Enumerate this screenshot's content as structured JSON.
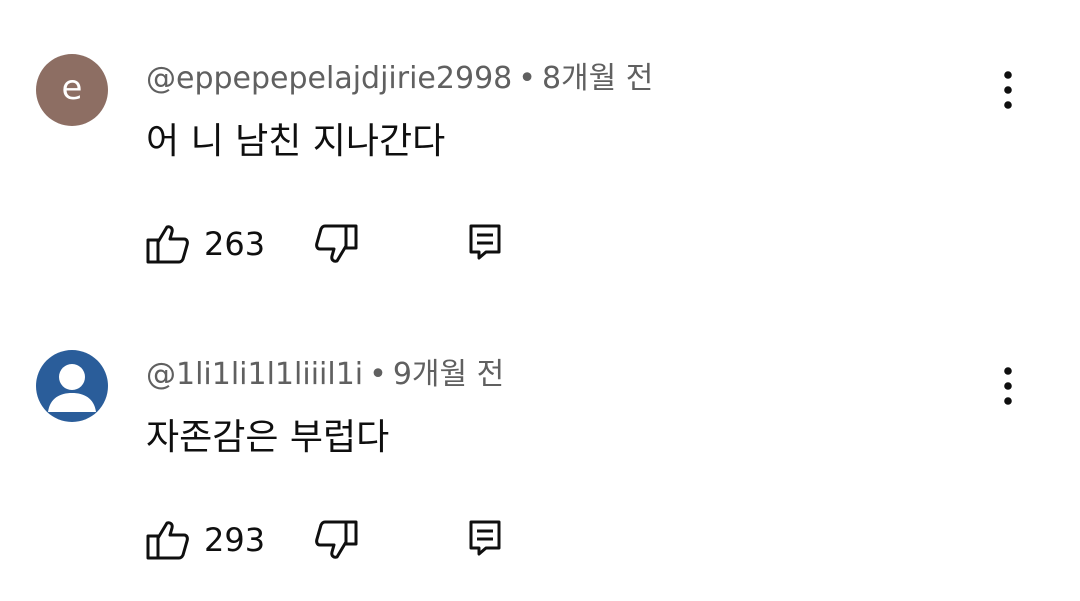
{
  "comments": [
    {
      "avatar": {
        "letter": "e",
        "color": "#8d6e63"
      },
      "author": "@eppepepelajdjirie2998",
      "separator": "•",
      "time": "8개월 전",
      "text": "어 니 남친 지나간다",
      "likes": "263"
    },
    {
      "avatar": {
        "letter": "",
        "color": "#2a5d9a",
        "icon": "person-icon"
      },
      "author": "@1li1li1l1liiil1i",
      "separator": "•",
      "time": "9개월 전",
      "text": "자존감은 부럽다",
      "likes": "293"
    }
  ],
  "icons": {
    "like": "thumb-up-icon",
    "dislike": "thumb-down-icon",
    "reply": "reply-icon",
    "more": "more-vertical-icon"
  }
}
